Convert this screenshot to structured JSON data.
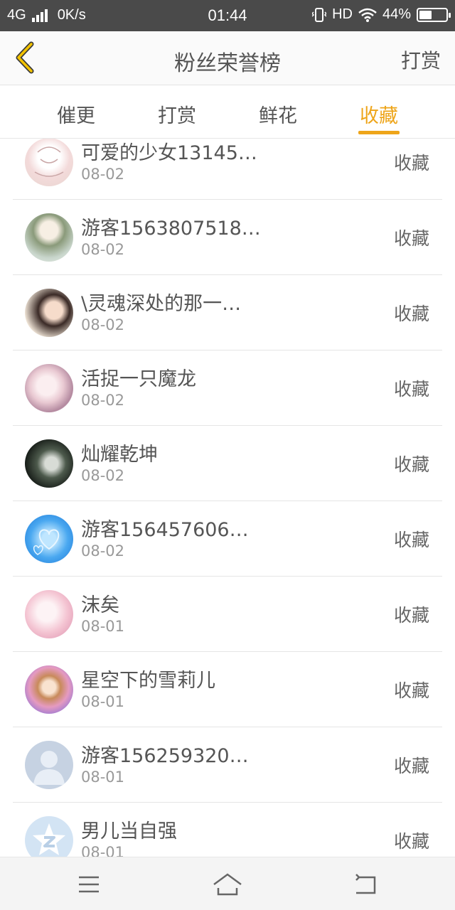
{
  "status_bar": {
    "network": "4G",
    "speed": "0K/s",
    "time": "01:44",
    "hd": "HD",
    "battery": "44%"
  },
  "header": {
    "title": "粉丝荣誉榜",
    "right_action": "打赏"
  },
  "tabs": [
    {
      "label": "催更",
      "active": false
    },
    {
      "label": "打赏",
      "active": false
    },
    {
      "label": "鲜花",
      "active": false
    },
    {
      "label": "收藏",
      "active": true
    }
  ],
  "accent_color": "#eea51a",
  "rows": [
    {
      "name": "可爱的少女13145…",
      "date": "08-02",
      "action": "收藏",
      "avatar": "avatar-sketch-girl-icon"
    },
    {
      "name": "游客1563807518…",
      "date": "08-02",
      "action": "收藏",
      "avatar": "avatar-anime-elf-icon"
    },
    {
      "name": "\\灵魂深处的那一…",
      "date": "08-02",
      "action": "收藏",
      "avatar": "avatar-photo-girl-icon"
    },
    {
      "name": "活捉一只魔龙",
      "date": "08-02",
      "action": "收藏",
      "avatar": "avatar-anime-foxgirl-icon"
    },
    {
      "name": "灿耀乾坤",
      "date": "08-02",
      "action": "收藏",
      "avatar": "avatar-dark-anime-icon"
    },
    {
      "name": "游客156457606…",
      "date": "08-02",
      "action": "收藏",
      "avatar": "avatar-blue-hearts-icon"
    },
    {
      "name": "沫矣",
      "date": "08-01",
      "action": "收藏",
      "avatar": "avatar-pink-anime-icon"
    },
    {
      "name": "星空下的雪莉儿",
      "date": "08-01",
      "action": "收藏",
      "avatar": "avatar-flower-anime-icon"
    },
    {
      "name": "游客156259320…",
      "date": "08-01",
      "action": "收藏",
      "avatar": "avatar-default-person-icon"
    },
    {
      "name": "男儿当自强",
      "date": "08-01",
      "action": "收藏",
      "avatar": "avatar-qzone-star-icon"
    }
  ]
}
